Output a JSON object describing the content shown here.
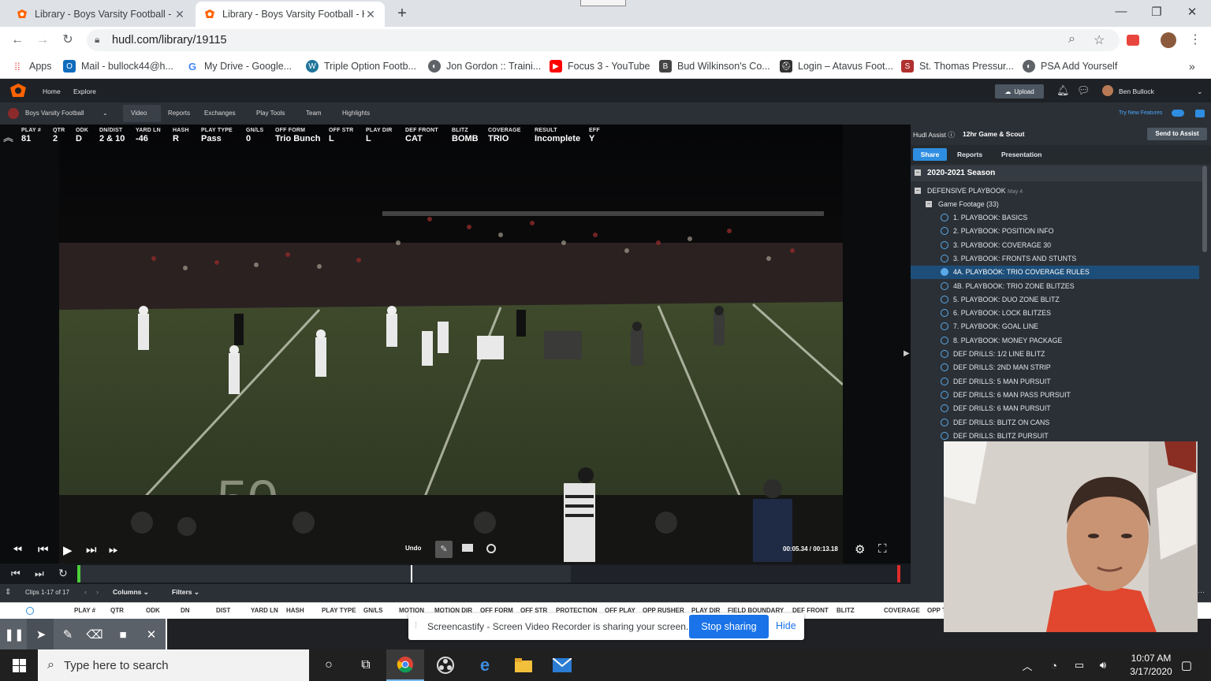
{
  "browser": {
    "tabs": [
      {
        "title": "Library - Boys Varsity Football - H",
        "active": false
      },
      {
        "title": "Library - Boys Varsity Football - H",
        "active": true
      }
    ],
    "new_tab_icon": "plus-icon",
    "url": "hudl.com/library/19115",
    "bookmarks": [
      {
        "label": "Apps",
        "icon": "apps-grid-icon",
        "color": "#ea4335"
      },
      {
        "label": "Mail - bullock44@h...",
        "icon": "outlook-icon",
        "color": "#0f6cbd"
      },
      {
        "label": "My Drive - Google...",
        "icon": "google-icon",
        "color": "#4285f4"
      },
      {
        "label": "Triple Option Footb...",
        "icon": "wordpress-icon",
        "color": "#21759b"
      },
      {
        "label": "Jon Gordon :: Traini...",
        "icon": "globe-icon",
        "color": "#5f6368"
      },
      {
        "label": "Focus 3 - YouTube",
        "icon": "youtube-icon",
        "color": "#ff0000"
      },
      {
        "label": "Bud Wilkinson's Co...",
        "icon": "site-icon",
        "color": "#444444"
      },
      {
        "label": "Login – Atavus Foot...",
        "icon": "helmet-icon",
        "color": "#333333"
      },
      {
        "label": "St. Thomas Pressur...",
        "icon": "site-icon",
        "color": "#b03030"
      },
      {
        "label": "PSA Add Yourself",
        "icon": "globe-icon",
        "color": "#5f6368"
      }
    ]
  },
  "hudl": {
    "nav": {
      "home": "Home",
      "explore": "Explore",
      "upload": "Upload",
      "user": "Ben Bullock"
    },
    "team": "Boys Varsity Football",
    "subnav": [
      "Video",
      "Reports",
      "Exchanges",
      "Play Tools",
      "Team",
      "Highlights"
    ],
    "try_features": "Try New Features",
    "play_data": [
      {
        "k": "PLAY #",
        "v": "81"
      },
      {
        "k": "QTR",
        "v": "2"
      },
      {
        "k": "ODK",
        "v": "D"
      },
      {
        "k": "DN/DIST",
        "v": "2 & 10"
      },
      {
        "k": "YARD LN",
        "v": "-46"
      },
      {
        "k": "HASH",
        "v": "R"
      },
      {
        "k": "PLAY TYPE",
        "v": "Pass"
      },
      {
        "k": "GN/LS",
        "v": "0"
      },
      {
        "k": "OFF FORM",
        "v": "Trio Bunch"
      },
      {
        "k": "OFF STR",
        "v": "L"
      },
      {
        "k": "PLAY DIR",
        "v": "L"
      },
      {
        "k": "DEF FRONT",
        "v": "CAT"
      },
      {
        "k": "BLITZ",
        "v": "BOMB"
      },
      {
        "k": "COVERAGE",
        "v": "TRIO"
      },
      {
        "k": "RESULT",
        "v": "Incomplete"
      },
      {
        "k": "EFF",
        "v": "Y"
      }
    ],
    "video": {
      "undo": "Undo",
      "time": "00:05.34 / 00:13.18",
      "progress": 0.405
    },
    "grid": {
      "clips": "Clips 1-17 of 17",
      "columns": "Columns",
      "filters": "Filters",
      "headers": [
        "PLAY #",
        "QTR",
        "ODK",
        "DN",
        "DIST",
        "YARD LN",
        "HASH",
        "PLAY TYPE",
        "GN/LS",
        "MOTION",
        "MOTION DIR",
        "OFF FORM",
        "OFF STR",
        "PROTECTION",
        "OFF PLAY",
        "OPP RUSHER",
        "PLAY DIR",
        "FIELD BOUNDARY",
        "DEF FRONT",
        "BLITZ",
        "COVERAGE",
        "OPP T"
      ]
    },
    "assist": {
      "label": "Hudl Assist",
      "status": "12hr Game & Scout",
      "send": "Send to Assist"
    },
    "panel_tabs": [
      "Share",
      "Reports",
      "Presentation"
    ],
    "season": "2020-2021 Season",
    "playbook": {
      "title": "DEFENSIVE PLAYBOOK",
      "date": "May 4"
    },
    "folder": "Game Footage (33)",
    "items": [
      "1. PLAYBOOK: BASICS",
      "2. PLAYBOOK: POSITION INFO",
      "3. PLAYBOOK: COVERAGE 30",
      "3. PLAYBOOK: FRONTS AND STUNTS",
      "4A. PLAYBOOK: TRIO COVERAGE RULES",
      "4B. PLAYBOOK: TRIO ZONE BLITZES",
      "5. PLAYBOOK: DUO ZONE BLITZ",
      "6. PLAYBOOK: LOCK BLITZES",
      "7. PLAYBOOK: GOAL LINE",
      "8. PLAYBOOK: MONEY PACKAGE",
      "DEF DRILLS: 1/2 LINE BLITZ",
      "DEF DRILLS: 2ND MAN STRIP",
      "DEF DRILLS: 5 MAN PURSUIT",
      "DEF DRILLS: 6 MAN PASS PURSUIT",
      "DEF DRILLS: 6 MAN PURSUIT",
      "DEF DRILLS: BLITZ ON CANS",
      "DEF DRILLS: BLITZ PURSUIT"
    ],
    "selected_index": 4
  },
  "screen_share": {
    "message": "Screencastify - Screen Video Recorder is sharing your screen.",
    "stop": "Stop sharing",
    "hide": "Hide"
  },
  "taskbar": {
    "search_placeholder": "Type here to search",
    "time": "10:07 AM",
    "date": "3/17/2020"
  }
}
